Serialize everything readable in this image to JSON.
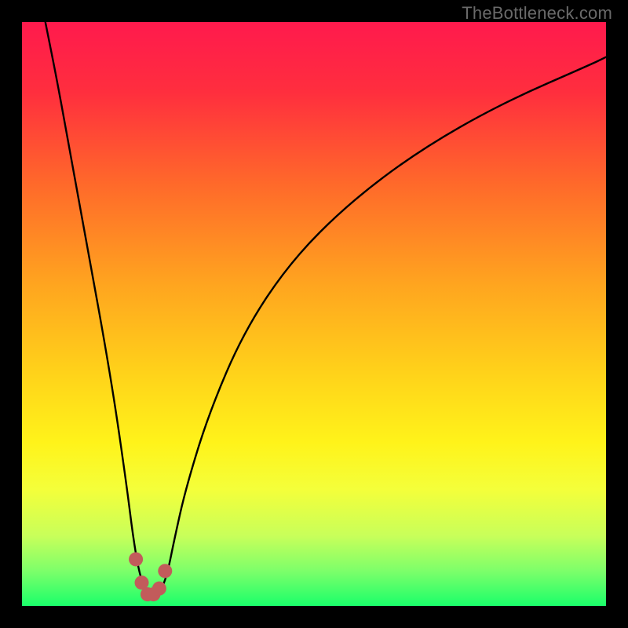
{
  "watermark": "TheBottleneck.com",
  "chart_data": {
    "type": "line",
    "title": "",
    "xlabel": "",
    "ylabel": "",
    "xlim": [
      0,
      100
    ],
    "ylim": [
      0,
      100
    ],
    "grid": false,
    "gradient_stops": [
      {
        "offset": 0,
        "color": "#ff1a4d"
      },
      {
        "offset": 0.12,
        "color": "#ff2e3e"
      },
      {
        "offset": 0.28,
        "color": "#ff6a2a"
      },
      {
        "offset": 0.45,
        "color": "#ffa51f"
      },
      {
        "offset": 0.6,
        "color": "#ffd21a"
      },
      {
        "offset": 0.72,
        "color": "#fff31a"
      },
      {
        "offset": 0.8,
        "color": "#f4ff3a"
      },
      {
        "offset": 0.88,
        "color": "#c8ff5a"
      },
      {
        "offset": 0.94,
        "color": "#7dff6a"
      },
      {
        "offset": 1.0,
        "color": "#1aff6a"
      }
    ],
    "series": [
      {
        "name": "bottleneck-curve",
        "stroke": "#000000",
        "stroke_width": 2.4,
        "x": [
          4,
          6,
          8,
          10,
          12,
          14,
          16,
          18,
          19,
          20,
          21,
          22,
          23,
          24,
          25,
          26,
          28,
          32,
          38,
          46,
          56,
          68,
          82,
          98,
          100
        ],
        "y": [
          100,
          90,
          79,
          68,
          57,
          46,
          34,
          20,
          12,
          6,
          3,
          2,
          2,
          3,
          6,
          11,
          20,
          33,
          47,
          59,
          69,
          78,
          86,
          93,
          94
        ]
      }
    ],
    "marker_cluster": {
      "name": "minimum-marker",
      "color": "#c25b5b",
      "radius": 9,
      "points": [
        {
          "x": 19.5,
          "y": 8
        },
        {
          "x": 20.5,
          "y": 4
        },
        {
          "x": 21.5,
          "y": 2
        },
        {
          "x": 22.5,
          "y": 2
        },
        {
          "x": 23.5,
          "y": 3
        },
        {
          "x": 24.5,
          "y": 6
        }
      ]
    }
  }
}
